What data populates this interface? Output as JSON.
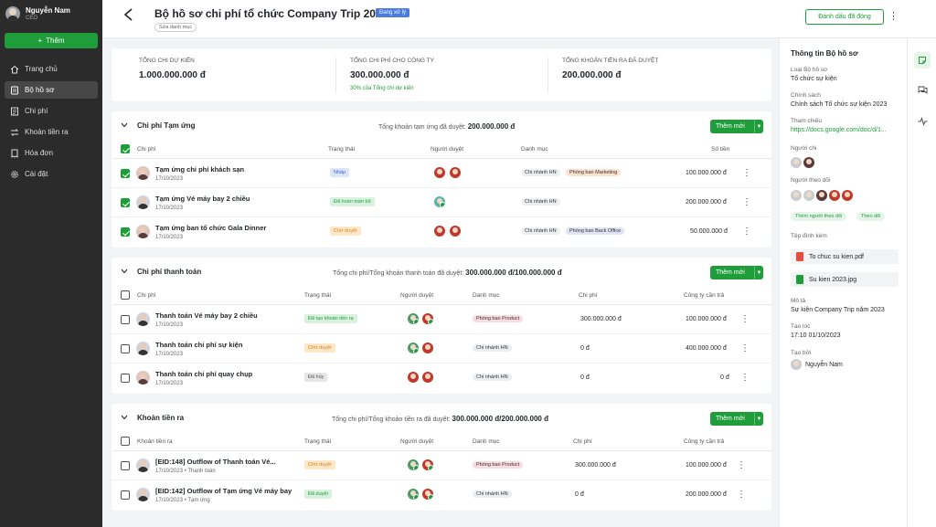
{
  "sidebar": {
    "user_name": "Nguyễn Nam",
    "user_role": "CEO",
    "add_label": "Thêm",
    "items": [
      {
        "label": "Trang chủ"
      },
      {
        "label": "Bộ hồ sơ"
      },
      {
        "label": "Chi phí"
      },
      {
        "label": "Khoản tiền ra"
      },
      {
        "label": "Hóa đơn"
      },
      {
        "label": "Cài đặt"
      }
    ]
  },
  "header": {
    "title": "Bộ hồ sơ chi phí tổ chức Company Trip 2023",
    "status": "Đang xử lý",
    "sub_link": "Sửa danh mục",
    "mark_done": "Đánh dấu đã đóng"
  },
  "stats": [
    {
      "label": "TỔNG CHI DỰ KIẾN",
      "value": "1.000.000.000 đ",
      "sub": ""
    },
    {
      "label": "TỔNG CHI PHÍ CHO CÔNG TY",
      "value": "300.000.000 đ",
      "sub": "30% của Tổng chi dự kiến"
    },
    {
      "label": "TỔNG KHOẢN TIỀN RA ĐÃ DUYỆT",
      "value": "200.000.000 đ",
      "sub": ""
    }
  ],
  "advances": {
    "title": "Chi phí Tạm ứng",
    "summary_label": "Tổng khoản tạm ứng đã duyệt:",
    "summary_value": "200.000.000 đ",
    "add_label": "Thêm mới",
    "headers": [
      "Chi phí",
      "Trạng thái",
      "Người duyệt",
      "Danh mục",
      "Số tiền"
    ],
    "rows": [
      {
        "name": "Tạm ứng chi phí khách sạn",
        "date": "17/10/2023",
        "status": "Nháp",
        "cats": [
          "Chi nhánh HN",
          "Phòng ban Marketing"
        ],
        "amount": "100.000.000 đ"
      },
      {
        "name": "Tạm ứng Vé máy bay 2 chiều",
        "date": "17/10/2023",
        "status": "Đã hoàn toàn bộ",
        "cats": [
          "Chi nhánh HN"
        ],
        "amount": "200.000.000 đ"
      },
      {
        "name": "Tạm ứng ban tổ chức Gala Dinner",
        "date": "17/10/2023",
        "status": "Chờ duyệt",
        "cats": [
          "Chi nhánh HN",
          "Phòng ban Back Office"
        ],
        "amount": "50.000.000 đ"
      }
    ]
  },
  "payments": {
    "title": "Chi phí thanh toán",
    "summary_label": "Tổng chi phí/Tổng khoản thanh toán đã duyệt:",
    "summary_value": "300.000.000 đ/100.000.000 đ",
    "add_label": "Thêm mới",
    "headers": [
      "Chi phí",
      "Trạng thái",
      "Người duyệt",
      "Danh mục",
      "Chi phí",
      "Công ty cần trả"
    ],
    "rows": [
      {
        "name": "Thanh toán Vé máy bay 2 chiều",
        "date": "17/10/2023",
        "status": "Đã tạo khoản tiền ra",
        "cat": "Phòng ban Product",
        "cost": "300.000.000 đ",
        "pay": "100.000.000 đ"
      },
      {
        "name": "Thanh toán chi phí sự kiện",
        "date": "17/10/2023",
        "status": "Chờ duyệt",
        "cat": "Chi nhánh HN",
        "cost": "0 đ",
        "pay": "400.000.000 đ"
      },
      {
        "name": "Thanh toán chi phí quay chụp",
        "date": "17/10/2023",
        "status": "Đã hủy",
        "cat": "Chi nhánh HN",
        "cost": "0 đ",
        "pay": "0 đ"
      }
    ]
  },
  "outflows": {
    "title": "Khoản tiền ra",
    "summary_label": "Tổng chi phí/Tổng khoản tiền ra đã duyệt:",
    "summary_value": "300.000.000 đ/200.000.000 đ",
    "add_label": "Thêm mới",
    "headers": [
      "Khoản tiền ra",
      "Trạng thái",
      "Người duyệt",
      "Danh mục",
      "Chi phí",
      "Công ty cần trả"
    ],
    "rows": [
      {
        "name": "[EID:148] Outflow of Thanh toán Vé...",
        "date": "17/10/2023 • Thanh toán",
        "status": "Chờ duyệt",
        "cat": "Phòng ban Product",
        "cost": "300.000.000 đ",
        "pay": "100.000.000 đ"
      },
      {
        "name": "[EID:142] Outflow of Tạm ứng Vé máy bay",
        "date": "17/10/2023 • Tạm ứng",
        "status": "Đã duyệt",
        "cat": "Chi nhánh HN",
        "cost": "0 đ",
        "pay": "200.000.000 đ"
      }
    ]
  },
  "info": {
    "title": "Thông tin Bộ hồ sơ",
    "type_label": "Loại Bộ hồ sơ",
    "type_value": "Tổ chức sự kiện",
    "policy_label": "Chính sách",
    "policy_value": "Chính sách Tổ chức sự kiện 2023",
    "ref_label": "Tham chiếu",
    "ref_value": "https://docs.google.com/doc/d/1...",
    "spender_label": "Người chi",
    "followers_label": "Người theo dõi",
    "add_follower": "Thêm người theo dõi",
    "follow": "Theo dõi",
    "attach_label": "Tệp đính kèm",
    "files": [
      "To chuc su kien.pdf",
      "Su kien 2023.jpg"
    ],
    "desc_label": "Mô tả",
    "desc_value": "Sự kiện Company Trip năm 2023",
    "created_label": "Tạo lúc",
    "created_value": "17:10 01/10/2023",
    "by_label": "Tạo bởi",
    "by_value": "Nguyễn Nam"
  },
  "colors": {
    "accent": "#1f9d3a",
    "sidebar": "#2b2b2b",
    "status_blue": "#4a7de3"
  }
}
